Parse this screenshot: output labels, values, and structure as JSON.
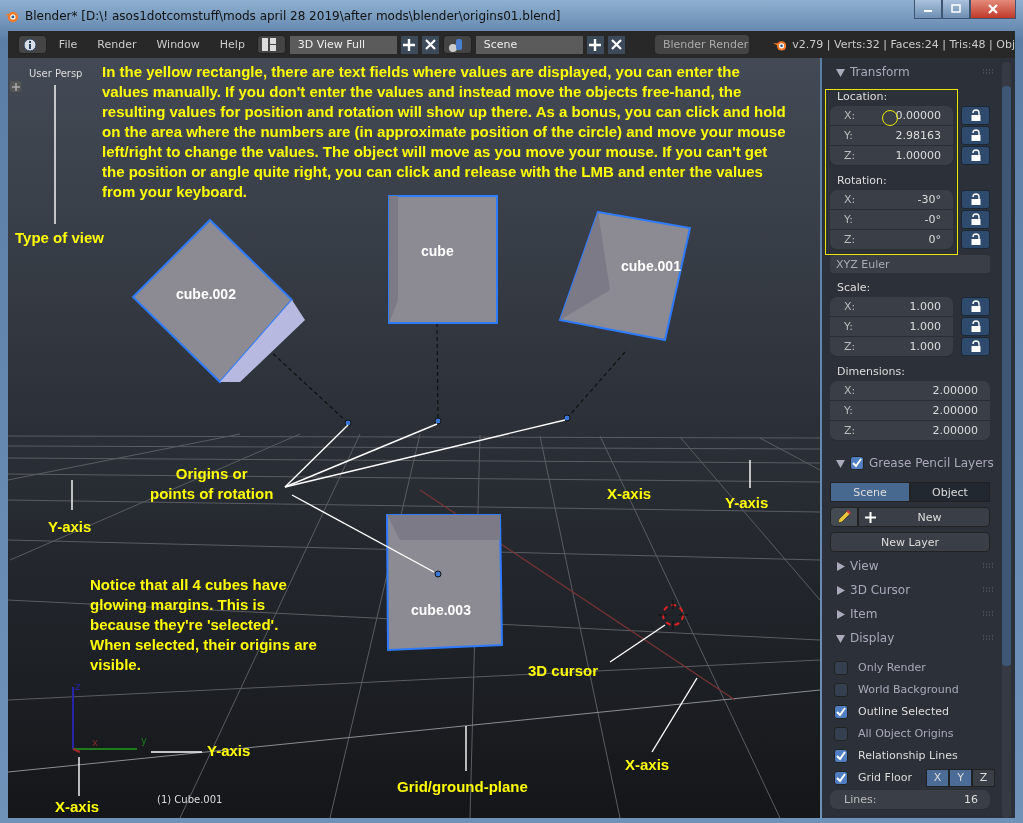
{
  "window": {
    "title": "Blender* [D:\\! asos1dotcomstuff\\mods april 28 2019\\after mods\\blender\\origins01.blend]"
  },
  "header": {
    "menus": [
      "File",
      "Render",
      "Window",
      "Help"
    ],
    "screen_layout": "3D View Full",
    "scene": "Scene",
    "render_engine": "Blender Render",
    "stats": "v2.79 | Verts:32 | Faces:24 | Tris:48 | Obj"
  },
  "viewport": {
    "view_name": "User Persp",
    "active_object": "(1) Cube.001",
    "objects": [
      {
        "label": "cube.002",
        "selected": true
      },
      {
        "label": "cube",
        "selected": true
      },
      {
        "label": "cube.001",
        "selected": true
      },
      {
        "label": "cube.003",
        "selected": true
      }
    ],
    "gizmo": {
      "z": "z",
      "y": "y",
      "x": "x"
    },
    "annotations": [
      "In the yellow rectangle, there are text fields where values are displayed, you can enter the values manually. If you don't enter the values and instead move the objects free-hand, the resulting values for position and rotation will show up there. As a bonus, you can click and hold on the area where the numbers are (in approximate position of the circle) and move your mouse left/right to change the values. The object will move as you move your mouse. If you can't get the position or angle quite right, you can click and release with the LMB and enter the values from your keyboard.",
      "Type of  view",
      "Origins or\npoints of rotation",
      "X-axis",
      "Y-axis",
      "Y-axis",
      "Notice that all 4 cubes have glowing margins. This is because they're 'selected'. When selected, their origins are visible.",
      "3D cursor",
      "X-axis",
      "Y-axis",
      "X-axis",
      "Grid/ground-plane"
    ]
  },
  "sidebar": {
    "transform": {
      "title": "Transform",
      "expanded": true,
      "location": {
        "label": "Location:",
        "fields": [
          {
            "axis": "X:",
            "value": "0.00000",
            "locked": false
          },
          {
            "axis": "Y:",
            "value": "2.98163",
            "locked": false
          },
          {
            "axis": "Z:",
            "value": "1.00000",
            "locked": false
          }
        ]
      },
      "rotation": {
        "label": "Rotation:",
        "fields": [
          {
            "axis": "X:",
            "value": "-30°",
            "locked": false
          },
          {
            "axis": "Y:",
            "value": "-0°",
            "locked": false
          },
          {
            "axis": "Z:",
            "value": "0°",
            "locked": false
          }
        ]
      },
      "rotation_mode": "XYZ Euler",
      "scale": {
        "label": "Scale:",
        "fields": [
          {
            "axis": "X:",
            "value": "1.000",
            "locked": false
          },
          {
            "axis": "Y:",
            "value": "1.000",
            "locked": false
          },
          {
            "axis": "Z:",
            "value": "1.000",
            "locked": false
          }
        ]
      },
      "dimensions": {
        "label": "Dimensions:",
        "fields": [
          {
            "axis": "X:",
            "value": "2.00000"
          },
          {
            "axis": "Y:",
            "value": "2.00000"
          },
          {
            "axis": "Z:",
            "value": "2.00000"
          }
        ]
      }
    },
    "grease_pencil": {
      "title": "Grease Pencil Layers",
      "enabled": true,
      "expanded": true,
      "tabs": [
        {
          "label": "Scene",
          "selected": true
        },
        {
          "label": "Object",
          "selected": false
        }
      ],
      "new_button": "New",
      "new_layer_button": "New Layer"
    },
    "panels": [
      {
        "title": "View",
        "expanded": false
      },
      {
        "title": "3D Cursor",
        "expanded": false
      },
      {
        "title": "Item",
        "expanded": false
      },
      {
        "title": "Display",
        "expanded": true
      }
    ],
    "display_options": [
      {
        "label": "Only Render",
        "checked": false
      },
      {
        "label": "World Background",
        "checked": false
      },
      {
        "label": "Outline Selected",
        "checked": true
      },
      {
        "label": "All Object Origins",
        "checked": false
      },
      {
        "label": "Relationship Lines",
        "checked": true
      }
    ],
    "grid_floor": {
      "label": "Grid Floor",
      "checked": true,
      "axes": [
        {
          "label": "X",
          "selected": true
        },
        {
          "label": "Y",
          "selected": true
        },
        {
          "label": "Z",
          "selected": false
        }
      ]
    },
    "lines": {
      "label": "Lines:",
      "value": "16"
    }
  }
}
